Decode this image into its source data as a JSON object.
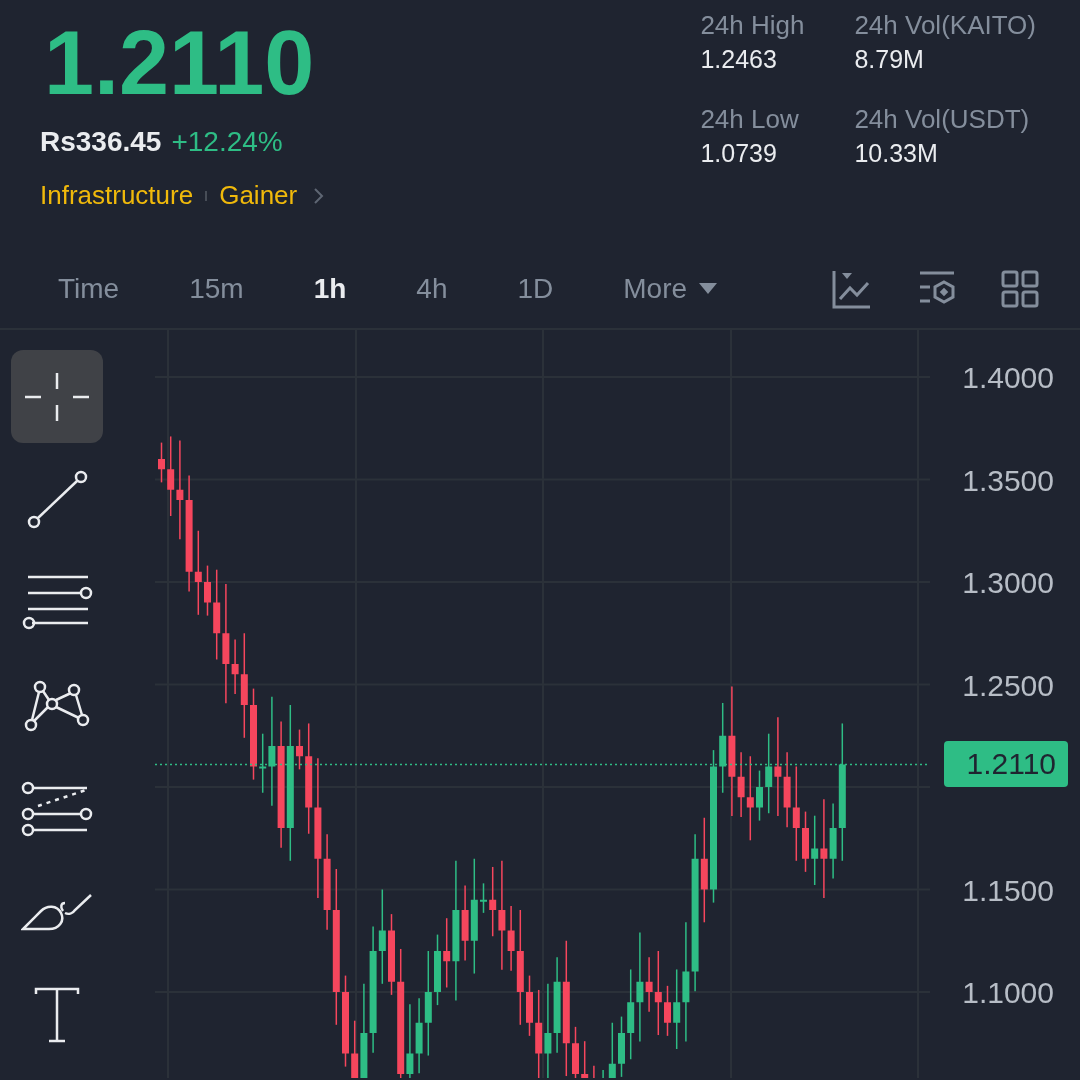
{
  "price": "1.2110",
  "fiat_price": "Rs336.45",
  "change": "+12.24%",
  "tags": [
    "Infrastructure",
    "Gainer"
  ],
  "stats": [
    {
      "label": "24h High",
      "value": "1.2463"
    },
    {
      "label": "24h Vol(KAITO)",
      "value": "8.79M"
    },
    {
      "label": "24h Low",
      "value": "1.0739"
    },
    {
      "label": "24h Vol(USDT)",
      "value": "10.33M"
    }
  ],
  "intervals": [
    {
      "label": "Time",
      "selected": false
    },
    {
      "label": "15m",
      "selected": false
    },
    {
      "label": "1h",
      "selected": true
    },
    {
      "label": "4h",
      "selected": false
    },
    {
      "label": "1D",
      "selected": false
    }
  ],
  "more": "More",
  "tools": [
    {
      "kind": "crosshair",
      "selected": true
    },
    {
      "kind": "trend-line",
      "selected": false
    },
    {
      "kind": "parallel-lines",
      "selected": false
    },
    {
      "kind": "pattern",
      "selected": false
    },
    {
      "kind": "fib",
      "selected": false
    },
    {
      "kind": "brush",
      "selected": false
    },
    {
      "kind": "text",
      "selected": false
    }
  ],
  "chart": {
    "y_labels": [
      "1.4000",
      "1.3500",
      "1.3000",
      "1.2500",
      "1.1500",
      "1.1000"
    ],
    "last_price": "1.2110"
  }
}
